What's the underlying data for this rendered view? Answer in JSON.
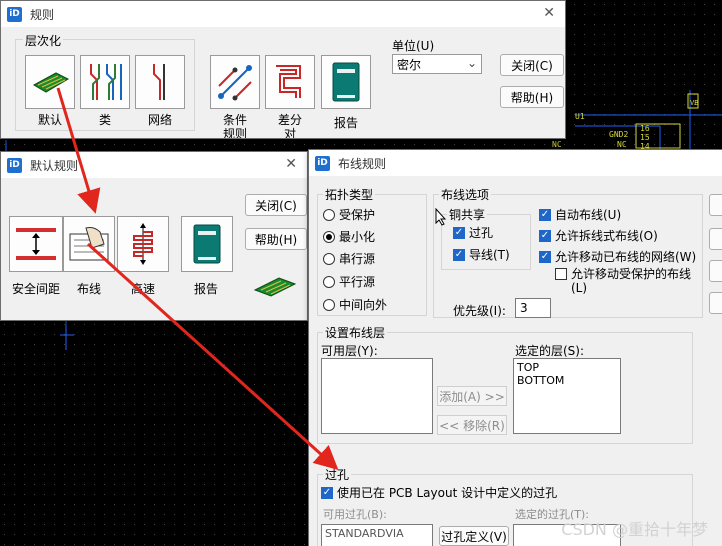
{
  "pcb": {
    "pin_labels": [
      "GND2",
      "NC",
      "16",
      "15",
      "U1",
      "14",
      "NC"
    ],
    "top_right_label": "VB"
  },
  "rules_window": {
    "title": "规则",
    "hierarchy_label": "层次化",
    "tools": [
      {
        "icon": "default-board-icon",
        "label": "默认"
      },
      {
        "icon": "net-class-icon",
        "label": "类"
      },
      {
        "icon": "net-icon",
        "label": "网络"
      },
      {
        "icon": "conditional-rules-icon",
        "label": "条件\n规则"
      },
      {
        "icon": "differential-pair-icon",
        "label": "差分\n对"
      },
      {
        "icon": "report-icon",
        "label": "报告"
      }
    ],
    "unit_label": "单位(U)",
    "unit_value": "密尔",
    "close_label": "关闭(C)",
    "help_label": "帮助(H)"
  },
  "default_rules_window": {
    "title": "默认规则",
    "tools": [
      {
        "icon": "clearance-icon",
        "label": "安全间距"
      },
      {
        "icon": "routing-icon",
        "label": "布线"
      },
      {
        "icon": "high-speed-icon",
        "label": "高速"
      },
      {
        "icon": "report-icon",
        "label": "报告"
      }
    ],
    "close_label": "关闭(C)",
    "help_label": "帮助(H)"
  },
  "routing_rules_window": {
    "title": "布线规则",
    "topology": {
      "label": "拓扑类型",
      "options": [
        "受保护",
        "最小化",
        "串行源",
        "平行源",
        "中间向外"
      ],
      "selected": "最小化"
    },
    "routing_options": {
      "label": "布线选项",
      "copper_share_label": "铜共享",
      "via_label": "过孔",
      "trace_label": "导线(T)",
      "auto_route_label": "自动布线(U)",
      "allow_ripup_label": "允许拆线式布线(O)",
      "allow_move_routed_label": "允许移动已布线的网络(W)",
      "allow_move_protected_label": "允许移动受保护的布线(L)",
      "priority_label": "优先级(I):",
      "priority_value": "3"
    },
    "layers": {
      "label": "设置布线层",
      "available_label": "可用层(Y):",
      "selected_label": "选定的层(S):",
      "selected_layers": [
        "TOP",
        "BOTTOM"
      ],
      "add_label": "添加(A) >>",
      "remove_label": "<< 移除(R)"
    },
    "vias": {
      "label": "过孔",
      "use_pcb_vias_label": "使用已在 PCB Layout 设计中定义的过孔",
      "available_vias_label": "可用过孔(B):",
      "available_vias": [
        "STANDARDVIA"
      ],
      "via_define_label": "过孔定义(V)",
      "selected_vias_label": "选定的过孔(T):"
    }
  },
  "watermark": "CSDN @重拾十年梦",
  "colors": {
    "arrow": "#e0261d",
    "pcb_trace": "#1f5fff",
    "pcb_text": "#d8d838",
    "grid_dot": "#3f3f3f"
  }
}
